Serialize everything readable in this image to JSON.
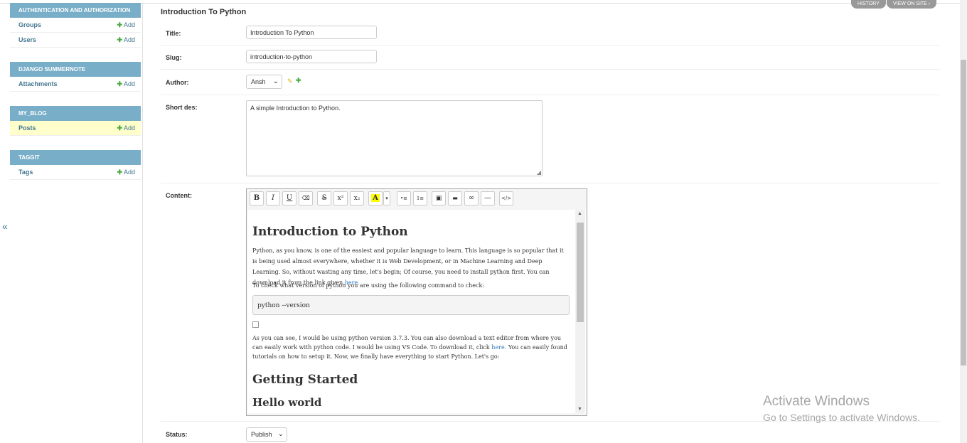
{
  "sidebar": {
    "modules": [
      {
        "caption": "Authentication and Authorization",
        "items": [
          {
            "name": "Groups",
            "add": "Add"
          },
          {
            "name": "Users",
            "add": "Add"
          }
        ]
      },
      {
        "caption": "Django Summernote",
        "items": [
          {
            "name": "Attachments",
            "add": "Add"
          }
        ]
      },
      {
        "caption": "My_Blog",
        "items": [
          {
            "name": "Posts",
            "add": "Add"
          }
        ]
      },
      {
        "caption": "Taggit",
        "items": [
          {
            "name": "Tags",
            "add": "Add"
          }
        ]
      }
    ],
    "collapse": "«"
  },
  "header": {
    "title": "Introduction To Python",
    "history": "History",
    "view_on_site": "View on site"
  },
  "form": {
    "title_label": "Title:",
    "title_value": "Introduction To Python",
    "slug_label": "Slug:",
    "slug_value": "introduction-to-python",
    "author_label": "Author:",
    "author_value": "Ansh",
    "short_label": "Short des:",
    "short_value": "A simple Introduction to Python.",
    "content_label": "Content:",
    "status_label": "Status:",
    "status_value": "Publish"
  },
  "toolbar": [
    "B",
    "I",
    "U",
    "⌫",
    "S",
    "x²",
    "x₂",
    "A",
    "▾",
    "•≡",
    "1≡",
    "▣",
    "▬",
    "∞",
    "—",
    "</>"
  ],
  "content": {
    "h1": "Introduction to Python",
    "p1": "Python, as you know, is one of the easiest and popular language to learn. This language is so popular that it is being used almost everywhere, whether it is Web Development, or in Machine Learning and Deep Learning. So, without wasting any time, let's begin; Of course, you need to install python first. You can download it from the link given",
    "p1_link": "here.",
    "p2": "To check what version of python you are using the following command to check:",
    "code": "python --version",
    "p3a": "As you can see, I would be using python version 3.7.3. You can also download a text editor from where you can easily work with python code. I would be using VS Code. To download it, click",
    "p3_link": "here.",
    "p3b": "You  can easily found tutorials on how to setup it. Now, we finally have everything to start Python. Let's go:",
    "h2": "Getting Started",
    "h3": "Hello world"
  },
  "watermark": {
    "line1": "Activate Windows",
    "line2": "Go to Settings to activate Windows."
  },
  "colors": {
    "module_caption": "#79aec8",
    "link": "#417690",
    "selected_row": "#ffffcc",
    "add_plus": "#4aaa43"
  }
}
